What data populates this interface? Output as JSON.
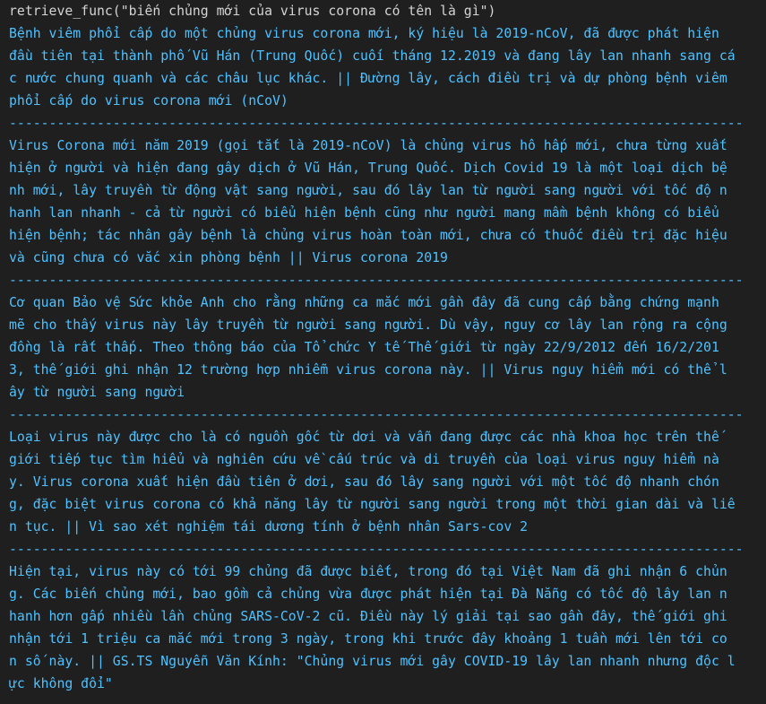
{
  "command": "retrieve_func(\"biến chủng mới của virus corona có tên là gì\")",
  "lines": [
    "Bệnh viêm phổi cấp do một chủng virus corona mới, ký hiệu là 2019-nCoV, đã được phát hiện",
    "đầu tiên tại thành phố Vũ Hán (Trung Quốc) cuối tháng 12.2019 và đang lây lan nhanh sang cá",
    "c nước chung quanh và các châu lục khác. || Đường lây, cách điều trị và dự phòng bệnh viêm",
    "phổi cấp do virus corona mới (nCoV)",
    "--------------------------------------------------------------------------------------------",
    "Virus Corona mới năm 2019 (gọi tắt là 2019-nCoV) là chủng virus hô hấp mới, chưa từng xuất",
    "hiện ở người và hiện đang gây dịch ở Vũ Hán, Trung Quốc. Dịch Covid 19 là một loại dịch bệ",
    "nh mới, lây truyền từ động vật sang người, sau đó lây lan từ người sang người với tốc độ n",
    "hanh lan nhanh - cả từ người có biểu hiện bệnh cũng như người mang mầm bệnh không có biểu",
    "hiện bệnh; tác nhân gây bệnh là chủng virus hoàn toàn mới, chưa có thuốc điều trị đặc hiệu",
    "và cũng chưa có vắc xin phòng bệnh || Virus corona 2019",
    "--------------------------------------------------------------------------------------------",
    "Cơ quan Bảo vệ Sức khỏe Anh cho rằng những ca mắc mới gần đây đã cung cấp bằng chứng mạnh",
    "mẽ cho thấy virus này lây truyền từ người sang người. Dù vậy, nguy cơ lây lan rộng ra cộng",
    "đồng là rất thấp. Theo thông báo của Tổ chức Y tế Thế giới từ ngày 22/9/2012 đến 16/2/201",
    "3, thế giới ghi nhận 12 trường hợp nhiễm virus corona này. || Virus nguy hiểm mới có thể l",
    "ây từ người sang người",
    "--------------------------------------------------------------------------------------------",
    "Loại virus này được cho là có nguồn gốc từ dơi và vẫn đang được các nhà khoa học trên thế",
    "giới tiếp tục tìm hiểu và nghiên cứu về cấu trúc và di truyền của loại virus nguy hiểm nà",
    "y. Virus corona xuất hiện đầu tiên ở dơi, sau đó lây sang người với một tốc độ nhanh chón",
    "g, đặc biệt virus corona có khả năng lây từ người sang người trong một thời gian dài và liê",
    "n tục. || Vì sao xét nghiệm tái dương tính ở bệnh nhân Sars-cov 2",
    "--------------------------------------------------------------------------------------------",
    "Hiện tại, virus này có tới 99 chủng đã được biết, trong đó tại Việt Nam đã ghi nhận 6 chủn",
    "g. Các biến chủng mới, bao gồm cả chủng vừa được phát hiện tại Đà Nẵng có tốc độ lây lan n",
    "hanh hơn gấp nhiều lần chủng SARS-CoV-2 cũ. Điều này lý giải tại sao gần đây, thế giới ghi",
    "nhận tới 1 triệu ca mắc mới trong 3 ngày, trong khi trước đây khoảng 1 tuần mới lên tới co",
    "n số này. || GS.TS Nguyễn Văn Kính: \"Chủng virus mới gây COVID-19 lây lan nhanh nhưng độc l",
    "ực không đổi\""
  ],
  "colors": {
    "background": "#1f1f1f",
    "command_text": "#d4d4d4",
    "output_text": "#4fc1ff"
  }
}
